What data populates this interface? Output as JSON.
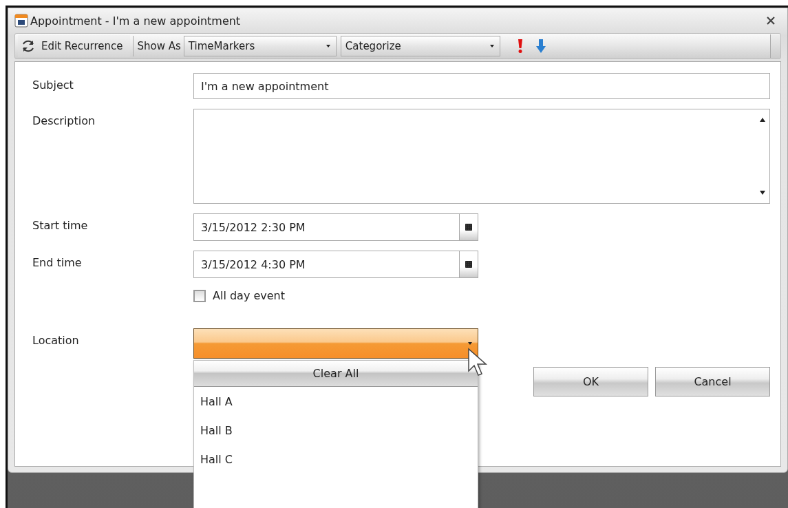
{
  "window": {
    "title": "Appointment - I'm a new appointment"
  },
  "toolbar": {
    "recurrence_button": "Edit Recurrence",
    "show_as": {
      "label": "Show As",
      "value": "TimeMarkers"
    },
    "categorize": {
      "value": "Categorize"
    }
  },
  "form": {
    "subject": {
      "label": "Subject",
      "value": "I'm a new appointment"
    },
    "description": {
      "label": "Description"
    },
    "start_time": {
      "label": "Start time",
      "value": "3/15/2012 2:30 PM"
    },
    "end_time": {
      "label": "End time",
      "value": "3/15/2012 4:30 PM"
    },
    "all_day": {
      "label": "All day event",
      "checked": false
    },
    "location": {
      "label": "Location",
      "expanded": true,
      "clear_button": "Clear All",
      "options": [
        {
          "label": "Hall A",
          "selected": false
        },
        {
          "label": "Hall B",
          "selected": false
        },
        {
          "label": "Hall C",
          "selected": false
        }
      ]
    }
  },
  "buttons": [
    {
      "label": "OK"
    },
    {
      "label": "Cancel"
    }
  ]
}
